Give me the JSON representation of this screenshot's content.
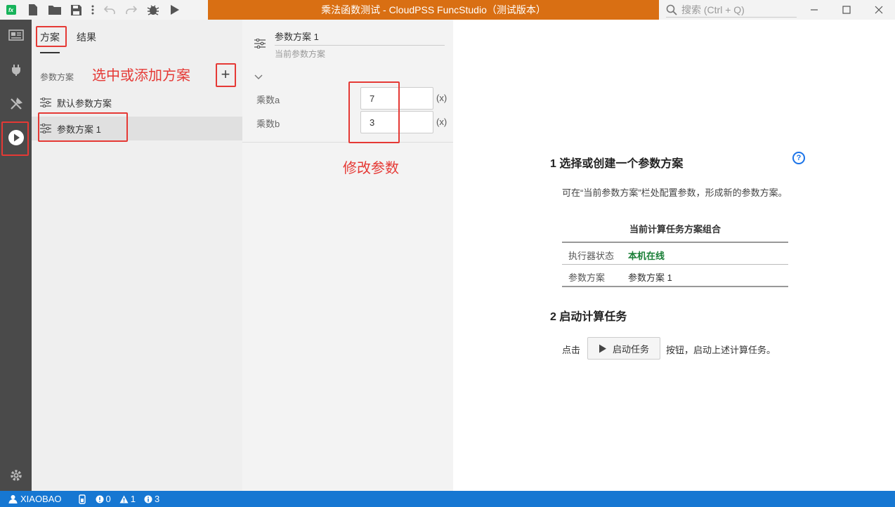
{
  "window": {
    "title": "乘法函数测试 - CloudPSS FuncStudio（测试版本）",
    "search_placeholder": "搜索 (Ctrl + Q)",
    "app_icon_text": "fx"
  },
  "sidebar": {
    "tabs": [
      "方案",
      "结果"
    ],
    "section_label": "参数方案",
    "schemes": [
      "默认参数方案",
      "参数方案 1"
    ]
  },
  "editor": {
    "scheme_name": "参数方案 1",
    "scheme_subtitle": "当前参数方案",
    "params": [
      {
        "label": "乘数a",
        "value": "7",
        "suffix": "(x)"
      },
      {
        "label": "乘数b",
        "value": "3",
        "suffix": "(x)"
      }
    ]
  },
  "main": {
    "step1_title": "1  选择或创建一个参数方案",
    "step1_desc": "可在“当前参数方案”栏处配置参数，形成新的参数方案。",
    "table_title": "当前计算任务方案组合",
    "rows": [
      {
        "key": "执行器状态",
        "value": "本机在线"
      },
      {
        "key": "参数方案",
        "value": "参数方案 1"
      }
    ],
    "step2_title": "2  启动计算任务",
    "step2_prefix": "点击",
    "run_button": "启动任务",
    "step2_suffix": "按钮，启动上述计算任务。"
  },
  "statusbar": {
    "user": "XIAOBAO",
    "errors": "0",
    "warnings": "1",
    "infos": "3"
  },
  "annotations": {
    "add_hint": "选中或添加方案",
    "modify_hint": "修改参数"
  },
  "colors": {
    "accent_orange": "#d96f13",
    "status_blue": "#1677d2",
    "annotation_red": "#e53935",
    "online_green": "#1a7f37"
  }
}
